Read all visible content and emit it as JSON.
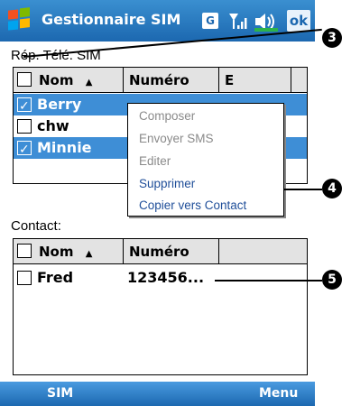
{
  "titlebar": {
    "title": "Gestionnaire SIM",
    "g_badge": "G",
    "ok_label": "ok",
    "logo_icon": "windows-flag-icon",
    "signal_icon": "signal-icon",
    "sound_icon": "speaker-icon"
  },
  "sim_section": {
    "label": "Rép. Télé. SIM",
    "columns": [
      "Nom",
      "Numéro",
      "E"
    ],
    "rows": [
      {
        "name": "Berry",
        "checked": true,
        "selected": true
      },
      {
        "name": "chw",
        "checked": false,
        "selected": false
      },
      {
        "name": "Minnie",
        "checked": true,
        "selected": true
      }
    ]
  },
  "context_menu": {
    "items": [
      {
        "label": "Composer",
        "enabled": false
      },
      {
        "label": "Envoyer SMS",
        "enabled": false
      },
      {
        "label": "Editer",
        "enabled": false
      },
      {
        "label": "Supprimer",
        "enabled": true
      },
      {
        "label": "Copier vers Contact",
        "enabled": true
      }
    ]
  },
  "contact_section": {
    "label": "Contact:",
    "columns": [
      "Nom",
      "Numéro"
    ],
    "rows": [
      {
        "name": "Fred",
        "number": "123456...",
        "checked": false
      }
    ]
  },
  "callouts": [
    "3",
    "4",
    "5"
  ],
  "bottombar": {
    "left": "SIM",
    "right": "Menu"
  },
  "colors": {
    "titlebar": "#1c68b0",
    "selection": "#3e8ed6",
    "menu_enabled": "#1f4e99",
    "menu_disabled": "#8a8a8a"
  }
}
